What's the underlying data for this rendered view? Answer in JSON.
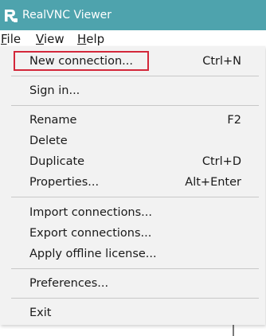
{
  "window": {
    "title": "RealVNC Viewer",
    "title_bar_color": "#4ea3ad",
    "icon": "realvnc-logo-icon"
  },
  "menubar": {
    "items": [
      {
        "label": "File",
        "mnemonic": "F",
        "rest": "ile"
      },
      {
        "label": "View",
        "mnemonic": "V",
        "rest": "iew"
      },
      {
        "label": "Help",
        "mnemonic": "H",
        "rest": "elp"
      }
    ]
  },
  "file_menu": {
    "new_connection": {
      "label": "New connection...",
      "shortcut": "Ctrl+N",
      "highlighted": true
    },
    "sign_in": {
      "label": "Sign in..."
    },
    "rename": {
      "label": "Rename",
      "shortcut": "F2"
    },
    "delete": {
      "label": "Delete"
    },
    "duplicate": {
      "label": "Duplicate",
      "shortcut": "Ctrl+D"
    },
    "properties": {
      "label": "Properties...",
      "shortcut": "Alt+Enter"
    },
    "import_connections": {
      "label": "Import connections..."
    },
    "export_connections": {
      "label": "Export connections..."
    },
    "apply_offline_license": {
      "label": "Apply offline license..."
    },
    "preferences": {
      "label": "Preferences..."
    },
    "exit": {
      "label": "Exit"
    }
  },
  "colors": {
    "highlight_border": "#d3273a",
    "menu_background": "#f2f2f2"
  }
}
